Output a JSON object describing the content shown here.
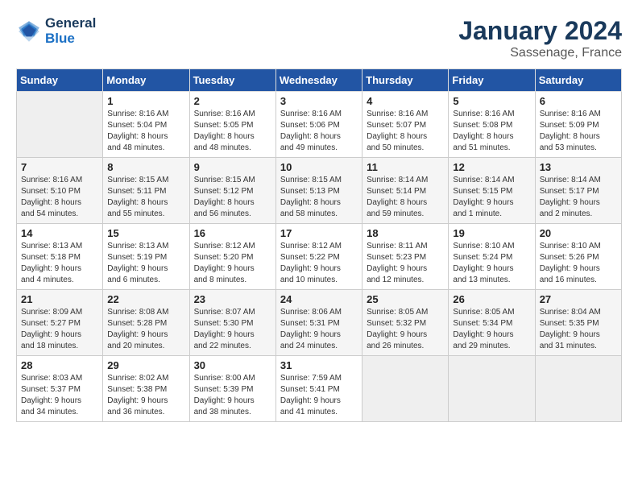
{
  "header": {
    "logo_line1": "General",
    "logo_line2": "Blue",
    "month": "January 2024",
    "location": "Sassenage, France"
  },
  "days_of_week": [
    "Sunday",
    "Monday",
    "Tuesday",
    "Wednesday",
    "Thursday",
    "Friday",
    "Saturday"
  ],
  "weeks": [
    [
      {
        "day": "",
        "info": ""
      },
      {
        "day": "1",
        "info": "Sunrise: 8:16 AM\nSunset: 5:04 PM\nDaylight: 8 hours\nand 48 minutes."
      },
      {
        "day": "2",
        "info": "Sunrise: 8:16 AM\nSunset: 5:05 PM\nDaylight: 8 hours\nand 48 minutes."
      },
      {
        "day": "3",
        "info": "Sunrise: 8:16 AM\nSunset: 5:06 PM\nDaylight: 8 hours\nand 49 minutes."
      },
      {
        "day": "4",
        "info": "Sunrise: 8:16 AM\nSunset: 5:07 PM\nDaylight: 8 hours\nand 50 minutes."
      },
      {
        "day": "5",
        "info": "Sunrise: 8:16 AM\nSunset: 5:08 PM\nDaylight: 8 hours\nand 51 minutes."
      },
      {
        "day": "6",
        "info": "Sunrise: 8:16 AM\nSunset: 5:09 PM\nDaylight: 8 hours\nand 53 minutes."
      }
    ],
    [
      {
        "day": "7",
        "info": "Sunrise: 8:16 AM\nSunset: 5:10 PM\nDaylight: 8 hours\nand 54 minutes."
      },
      {
        "day": "8",
        "info": "Sunrise: 8:15 AM\nSunset: 5:11 PM\nDaylight: 8 hours\nand 55 minutes."
      },
      {
        "day": "9",
        "info": "Sunrise: 8:15 AM\nSunset: 5:12 PM\nDaylight: 8 hours\nand 56 minutes."
      },
      {
        "day": "10",
        "info": "Sunrise: 8:15 AM\nSunset: 5:13 PM\nDaylight: 8 hours\nand 58 minutes."
      },
      {
        "day": "11",
        "info": "Sunrise: 8:14 AM\nSunset: 5:14 PM\nDaylight: 8 hours\nand 59 minutes."
      },
      {
        "day": "12",
        "info": "Sunrise: 8:14 AM\nSunset: 5:15 PM\nDaylight: 9 hours\nand 1 minute."
      },
      {
        "day": "13",
        "info": "Sunrise: 8:14 AM\nSunset: 5:17 PM\nDaylight: 9 hours\nand 2 minutes."
      }
    ],
    [
      {
        "day": "14",
        "info": "Sunrise: 8:13 AM\nSunset: 5:18 PM\nDaylight: 9 hours\nand 4 minutes."
      },
      {
        "day": "15",
        "info": "Sunrise: 8:13 AM\nSunset: 5:19 PM\nDaylight: 9 hours\nand 6 minutes."
      },
      {
        "day": "16",
        "info": "Sunrise: 8:12 AM\nSunset: 5:20 PM\nDaylight: 9 hours\nand 8 minutes."
      },
      {
        "day": "17",
        "info": "Sunrise: 8:12 AM\nSunset: 5:22 PM\nDaylight: 9 hours\nand 10 minutes."
      },
      {
        "day": "18",
        "info": "Sunrise: 8:11 AM\nSunset: 5:23 PM\nDaylight: 9 hours\nand 12 minutes."
      },
      {
        "day": "19",
        "info": "Sunrise: 8:10 AM\nSunset: 5:24 PM\nDaylight: 9 hours\nand 13 minutes."
      },
      {
        "day": "20",
        "info": "Sunrise: 8:10 AM\nSunset: 5:26 PM\nDaylight: 9 hours\nand 16 minutes."
      }
    ],
    [
      {
        "day": "21",
        "info": "Sunrise: 8:09 AM\nSunset: 5:27 PM\nDaylight: 9 hours\nand 18 minutes."
      },
      {
        "day": "22",
        "info": "Sunrise: 8:08 AM\nSunset: 5:28 PM\nDaylight: 9 hours\nand 20 minutes."
      },
      {
        "day": "23",
        "info": "Sunrise: 8:07 AM\nSunset: 5:30 PM\nDaylight: 9 hours\nand 22 minutes."
      },
      {
        "day": "24",
        "info": "Sunrise: 8:06 AM\nSunset: 5:31 PM\nDaylight: 9 hours\nand 24 minutes."
      },
      {
        "day": "25",
        "info": "Sunrise: 8:05 AM\nSunset: 5:32 PM\nDaylight: 9 hours\nand 26 minutes."
      },
      {
        "day": "26",
        "info": "Sunrise: 8:05 AM\nSunset: 5:34 PM\nDaylight: 9 hours\nand 29 minutes."
      },
      {
        "day": "27",
        "info": "Sunrise: 8:04 AM\nSunset: 5:35 PM\nDaylight: 9 hours\nand 31 minutes."
      }
    ],
    [
      {
        "day": "28",
        "info": "Sunrise: 8:03 AM\nSunset: 5:37 PM\nDaylight: 9 hours\nand 34 minutes."
      },
      {
        "day": "29",
        "info": "Sunrise: 8:02 AM\nSunset: 5:38 PM\nDaylight: 9 hours\nand 36 minutes."
      },
      {
        "day": "30",
        "info": "Sunrise: 8:00 AM\nSunset: 5:39 PM\nDaylight: 9 hours\nand 38 minutes."
      },
      {
        "day": "31",
        "info": "Sunrise: 7:59 AM\nSunset: 5:41 PM\nDaylight: 9 hours\nand 41 minutes."
      },
      {
        "day": "",
        "info": ""
      },
      {
        "day": "",
        "info": ""
      },
      {
        "day": "",
        "info": ""
      }
    ]
  ]
}
